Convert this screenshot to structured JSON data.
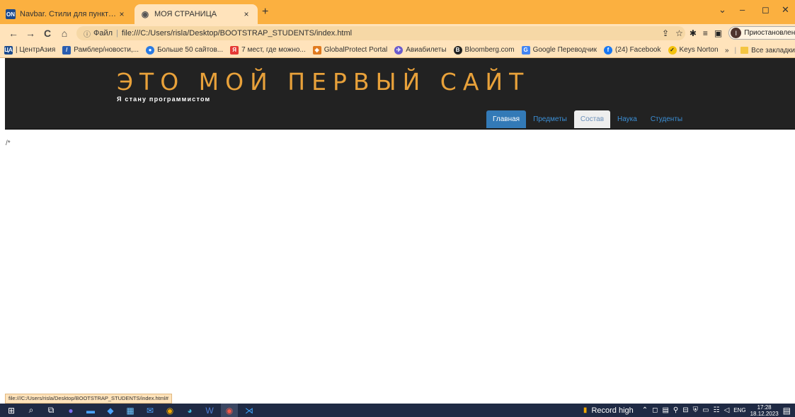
{
  "tabs": [
    {
      "favicon": "ON",
      "title": "Navbar. Стили для пунктов меню",
      "close": "×"
    },
    {
      "favicon": "globe-icon",
      "title": "МОЯ СТРАНИЦА",
      "close": "×"
    }
  ],
  "new_tab": "+",
  "window_controls": [
    "⌄",
    "–",
    "◻",
    "✕"
  ],
  "toolbar": {
    "back": "←",
    "forward": "→",
    "reload": "C",
    "home": "⌂",
    "address_prefix": "Файл",
    "address": "file:///C:/Users/risla/Desktop/BOOTSTRAP_STUDENTS/index.html",
    "profile_initial": "I",
    "profile_label": "Приостановлена",
    "menu": "⋮"
  },
  "bookmarks": [
    {
      "label": "| ЦентрАзия",
      "icon": "ЦА",
      "color": "#1c4a8c"
    },
    {
      "label": "Рамблер/новости,...",
      "icon": "/",
      "color": "#2a5db0"
    },
    {
      "label": "Больше 50 сайтов...",
      "icon": "●",
      "color": "#2a7ae2"
    },
    {
      "label": "7 мест, где можно...",
      "icon": "Я",
      "color": "#e53935"
    },
    {
      "label": "GlobalProtect Portal",
      "icon": "◈",
      "color": "#e07a1f"
    },
    {
      "label": "Авиабилеты",
      "icon": "✈",
      "color": "#6a5acd"
    },
    {
      "label": "Bloomberg.com",
      "icon": "B",
      "color": "#222"
    },
    {
      "label": "Google Переводчик",
      "icon": "G",
      "color": "#4285f4"
    },
    {
      "label": "(24) Facebook",
      "icon": "f",
      "color": "#1877f2"
    },
    {
      "label": "Keys Norton",
      "icon": "✓",
      "color": "#f4c20d"
    }
  ],
  "bookmarks_more": "»",
  "all_bookmarks": "Все закладки",
  "site": {
    "title": "ЭТО МОЙ ПЕРВЫЙ САЙТ",
    "subtitle": "Я стану программистом",
    "nav": [
      "Главная",
      "Предметы",
      "Состав",
      "Наука",
      "Студенты"
    ]
  },
  "stray_text": "/*",
  "status_url": "file:///C:/Users/risla/Desktop/BOOTSTRAP_STUDENTS/index.html#",
  "taskbar": {
    "record_label": "Record high",
    "lang": "ENG",
    "time": "17:28",
    "date": "18.12.2023"
  }
}
